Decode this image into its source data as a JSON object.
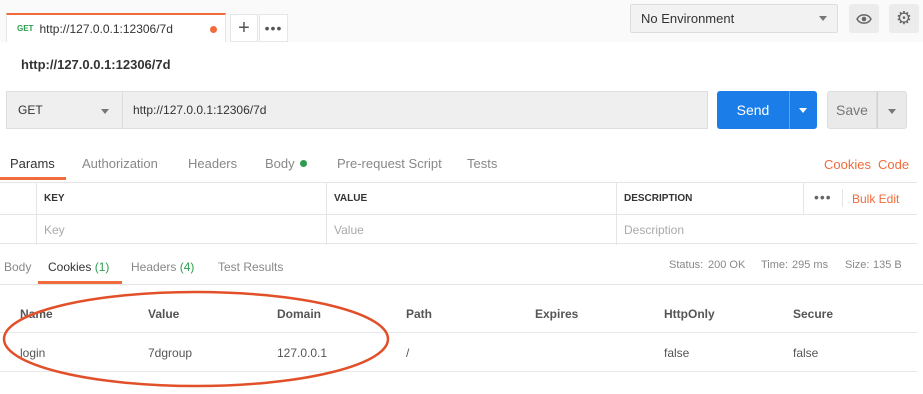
{
  "tab": {
    "method": "GET",
    "url": "http://127.0.0.1:12306/7d"
  },
  "tabbar": {
    "add_label": "+",
    "more_label": "•••"
  },
  "environment": {
    "selected": "No Environment"
  },
  "request": {
    "title": "http://127.0.0.1:12306/7d",
    "method": "GET",
    "url": "http://127.0.0.1:12306/7d",
    "send_label": "Send",
    "save_label": "Save"
  },
  "request_tabs": {
    "params": "Params",
    "authorization": "Authorization",
    "headers": "Headers",
    "body": "Body",
    "prerequest": "Pre-request Script",
    "tests": "Tests",
    "cookies_link": "Cookies",
    "code_link": "Code"
  },
  "params_table": {
    "headers": {
      "key": "KEY",
      "value": "VALUE",
      "description": "DESCRIPTION"
    },
    "placeholders": {
      "key": "Key",
      "value": "Value",
      "description": "Description"
    },
    "more": "•••",
    "bulk_edit": "Bulk Edit"
  },
  "response_tabs": {
    "body": "Body",
    "cookies": "Cookies",
    "cookies_count": "(1)",
    "headers": "Headers",
    "headers_count": "(4)",
    "test_results": "Test Results"
  },
  "response_status": {
    "status_label": "Status:",
    "status_value": "200 OK",
    "time_label": "Time:",
    "time_value": "295 ms",
    "size_label": "Size:",
    "size_value": "135 B"
  },
  "cookies_table": {
    "columns": [
      "Name",
      "Value",
      "Domain",
      "Path",
      "Expires",
      "HttpOnly",
      "Secure"
    ],
    "rows": [
      [
        "login",
        "7dgroup",
        "127.0.0.1",
        "/",
        "",
        "false",
        "false"
      ]
    ]
  },
  "colors": {
    "accent": "#f26b3a",
    "send": "#1b7ee8",
    "success": "#2c9d4f",
    "annotation": "#e2502a"
  }
}
